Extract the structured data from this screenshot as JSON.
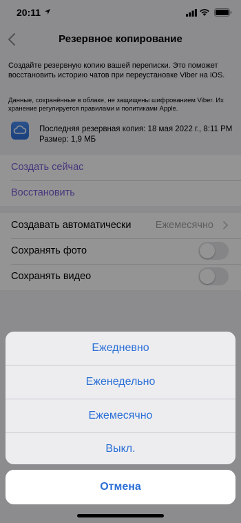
{
  "status": {
    "time": "20:11"
  },
  "nav": {
    "title": "Резервное копирование"
  },
  "info": {
    "intro": "Создайте резервную копию вашей переписки. Это поможет восстановить историю чатов при переустановке Viber на iOS.",
    "note": "Данные, сохранённые в облаке, не защищены шифрованием Viber. Их хранение регулируется правилами и политиками Apple.",
    "last_backup": "Последняя резервная копия: 18 мая 2022 г., 8:11 PM",
    "size": "Размер: 1,9 МБ"
  },
  "actions": {
    "create": "Создать сейчас",
    "restore": "Восстановить"
  },
  "settings": {
    "auto_label": "Создавать автоматически",
    "auto_value": "Ежемесячно",
    "photo_label": "Сохранять фото",
    "video_label": "Сохранять видео"
  },
  "sheet": {
    "options": [
      "Ежедневно",
      "Еженедельно",
      "Ежемесячно",
      "Выкл."
    ],
    "cancel": "Отмена"
  },
  "colors": {
    "accent": "#2b6fd6",
    "link": "#7a5cd6"
  }
}
